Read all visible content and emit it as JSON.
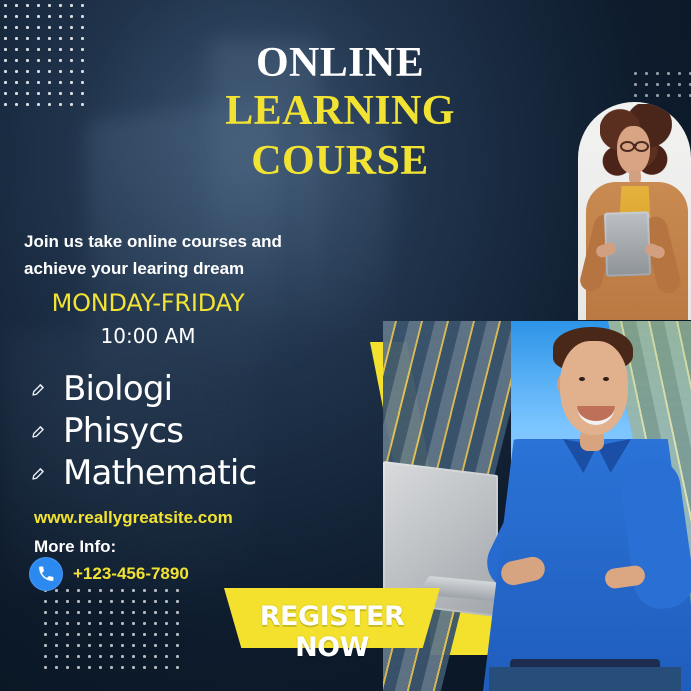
{
  "headline": {
    "line1": "ONLINE",
    "line2": "LEARNING",
    "line3": "COURSE"
  },
  "intro": {
    "line1": "Join us take online courses and",
    "line2": "achieve your learing dream"
  },
  "schedule": {
    "days": "MONDAY-FRIDAY",
    "time": "10:00 AM"
  },
  "subjects": [
    {
      "label": "Biologi",
      "icon": "pencil-icon"
    },
    {
      "label": "Phisycs",
      "icon": "pencil-icon"
    },
    {
      "label": "Mathematic",
      "icon": "pencil-icon"
    }
  ],
  "contact": {
    "website": "www.reallygreatsite.com",
    "more_info": "More Info:",
    "phone": "+123-456-7890",
    "phone_icon": "phone-icon"
  },
  "cta": {
    "label": "REGISTER NOW"
  },
  "colors": {
    "accent": "#f2e332",
    "phone_badge": "#2c89ef",
    "text": "#ffffff",
    "background": "#0b1a2b"
  }
}
